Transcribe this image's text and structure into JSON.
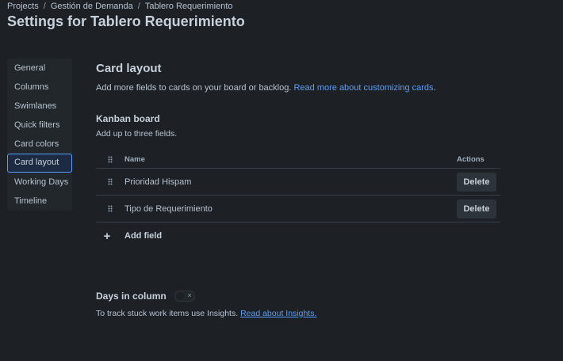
{
  "breadcrumb": {
    "items": [
      "Projects",
      "Gestión de Demanda",
      "Tablero Requerimiento"
    ],
    "separator": "/"
  },
  "page_title": "Settings for Tablero Requerimiento",
  "sidebar": {
    "items": [
      {
        "label": "General"
      },
      {
        "label": "Columns"
      },
      {
        "label": "Swimlanes"
      },
      {
        "label": "Quick filters"
      },
      {
        "label": "Card colors"
      },
      {
        "label": "Card layout",
        "active": true
      },
      {
        "label": "Working Days"
      },
      {
        "label": "Timeline"
      }
    ]
  },
  "card_layout": {
    "title": "Card layout",
    "description": "Add more fields to cards on your board or backlog. ",
    "link": "Read more about customizing cards",
    "link_suffix": "."
  },
  "kanban": {
    "title": "Kanban board",
    "description": "Add up to three fields.",
    "table": {
      "headers": {
        "name": "Name",
        "actions": "Actions"
      },
      "rows": [
        {
          "name": "Prioridad Hispam",
          "action": "Delete"
        },
        {
          "name": "Tipo de Requerimiento",
          "action": "Delete"
        }
      ]
    },
    "add_field_label": "Add field"
  },
  "days_in_column": {
    "title": "Days in column",
    "toggle_on": false,
    "toggle_off_glyph": "×",
    "description": "To track stuck work items use Insights. ",
    "link": "Read about Insights."
  },
  "colors": {
    "background": "#1d2125",
    "accent": "#579dff",
    "text": "#b6c2cf"
  }
}
